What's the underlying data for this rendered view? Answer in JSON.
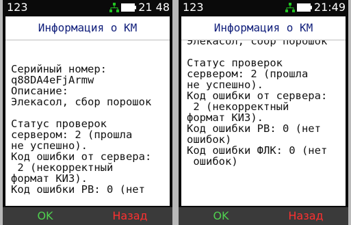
{
  "colors": {
    "title": "#0f1d7a",
    "ok": "#4fd14f",
    "back": "#ff3030",
    "network_icon": "#21c421"
  },
  "screens": [
    {
      "status": {
        "left": "123",
        "time": "21 48",
        "network_icon": "network-icon",
        "battery_icon": "battery-icon"
      },
      "title": "Информация о КМ",
      "lines": [
        "Серийный номер:",
        "q88DA4eFjArmw",
        "Описание:",
        "Элекасол, сбор порошок",
        "",
        "Статус проверок",
        "сервером: 2 (прошла",
        "не успешно).",
        "Код ошибки от сервера:",
        " 2 (некорректный",
        "формат КИЗ).",
        "Код ошибки РВ: 0 (нет"
      ],
      "softkeys": {
        "ok": "OK",
        "back": "Назад"
      }
    },
    {
      "status": {
        "left": "123",
        "time": "21:49",
        "network_icon": "network-icon",
        "battery_icon": "battery-icon"
      },
      "title": "Информация о КМ",
      "lines": [
        "Элекасол, сбор порошок",
        "",
        "Статус проверок",
        "сервером: 2 (прошла",
        "не успешно).",
        "Код ошибки от сервера:",
        " 2 (некорректный",
        "формат КИЗ).",
        "Код ошибки РВ: 0 (нет",
        "ошибок)",
        "Код ошибки ФЛК: 0 (нет",
        " ошибок)"
      ],
      "softkeys": {
        "ok": "OK",
        "back": "Назад"
      }
    }
  ]
}
